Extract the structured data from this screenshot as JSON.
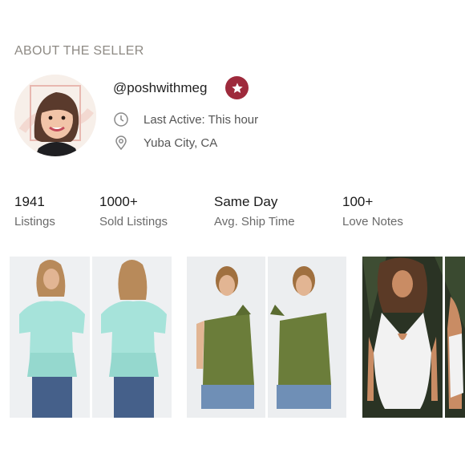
{
  "section": {
    "title": "ABOUT THE SELLER"
  },
  "seller": {
    "username": "@poshwithmeg",
    "badge_icon": "star-badge-icon",
    "last_active": "Last Active: This hour",
    "location": "Yuba City, CA"
  },
  "stats": [
    {
      "value": "1941",
      "label": "Listings"
    },
    {
      "value": "1000+",
      "label": "Sold Listings"
    },
    {
      "value": "Same Day",
      "label": "Avg. Ship Time"
    },
    {
      "value": "100+",
      "label": "Love Notes"
    }
  ],
  "listings": [
    {
      "name": "mint peplum top",
      "color": "#a6e3da"
    },
    {
      "name": "olive one-shoulder top",
      "color": "#6b7d3a"
    },
    {
      "name": "white halter bodysuit",
      "color": "#f2f2f2"
    }
  ],
  "colors": {
    "badge": "#9e2a3c",
    "title": "#8e8a84"
  }
}
